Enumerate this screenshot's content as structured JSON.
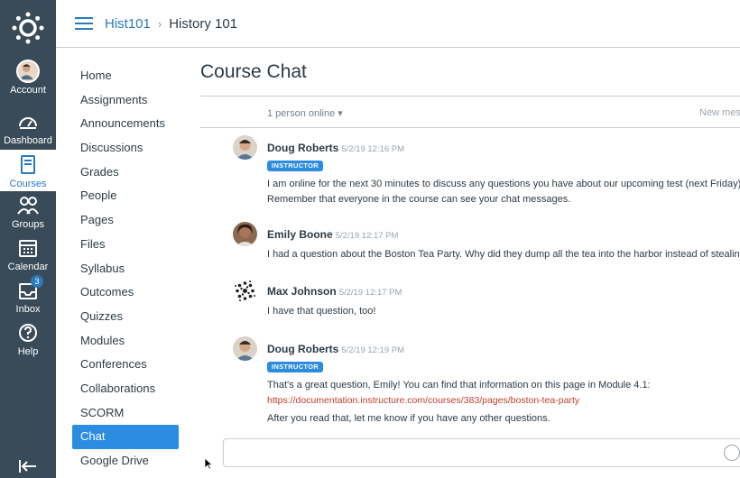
{
  "global_nav": {
    "items": [
      {
        "label": "Account",
        "icon": "account-avatar"
      },
      {
        "label": "Dashboard",
        "icon": "dashboard-icon"
      },
      {
        "label": "Courses",
        "icon": "courses-icon",
        "active": true
      },
      {
        "label": "Groups",
        "icon": "groups-icon"
      },
      {
        "label": "Calendar",
        "icon": "calendar-icon"
      },
      {
        "label": "Inbox",
        "icon": "inbox-icon",
        "badge": "3"
      },
      {
        "label": "Help",
        "icon": "help-icon"
      }
    ]
  },
  "header": {
    "crumb_link": "Hist101",
    "crumb_sep": "›",
    "crumb_current": "History 101"
  },
  "course_nav": {
    "items": [
      "Home",
      "Assignments",
      "Announcements",
      "Discussions",
      "Grades",
      "People",
      "Pages",
      "Files",
      "Syllabus",
      "Outcomes",
      "Quizzes",
      "Modules",
      "Conferences",
      "Collaborations",
      "SCORM",
      "Chat",
      "Google Drive"
    ],
    "active": "Chat"
  },
  "chat": {
    "title": "Course Chat",
    "online": "1 person online ▾",
    "new_messages": "New mess",
    "messages": [
      {
        "name": "Doug Roberts",
        "time": "5/2/19 12:16 PM",
        "role": "INSTRUCTOR",
        "lines": [
          "I am online for the next 30 minutes to discuss any questions you have about our upcoming test (next Friday).",
          "Remember that everyone in the course can see your chat messages."
        ]
      },
      {
        "name": "Emily Boone",
        "time": "5/2/19 12:17 PM",
        "lines": [
          "I had a question about the Boston Tea Party. Why did they dump all the tea into the harbor instead of stealing it?"
        ]
      },
      {
        "name": "Max Johnson",
        "time": "5/2/19 12:17 PM",
        "lines": [
          "I have that question, too!"
        ]
      },
      {
        "name": "Doug Roberts",
        "time": "5/2/19 12:19 PM",
        "role": "INSTRUCTOR",
        "lines": [
          "That's a great question, Emily! You can find that information on this page in Module 4.1:"
        ],
        "link": "https://documentation.instructure.com/courses/383/pages/boston-tea-party",
        "after": "After you read that, let me know if you have any other questions."
      }
    ]
  },
  "colors": {
    "nav_bg": "#394b58",
    "brand_blue": "#2b7abc",
    "active_item": "#2b8ce0",
    "link_red": "#c23c2d"
  }
}
